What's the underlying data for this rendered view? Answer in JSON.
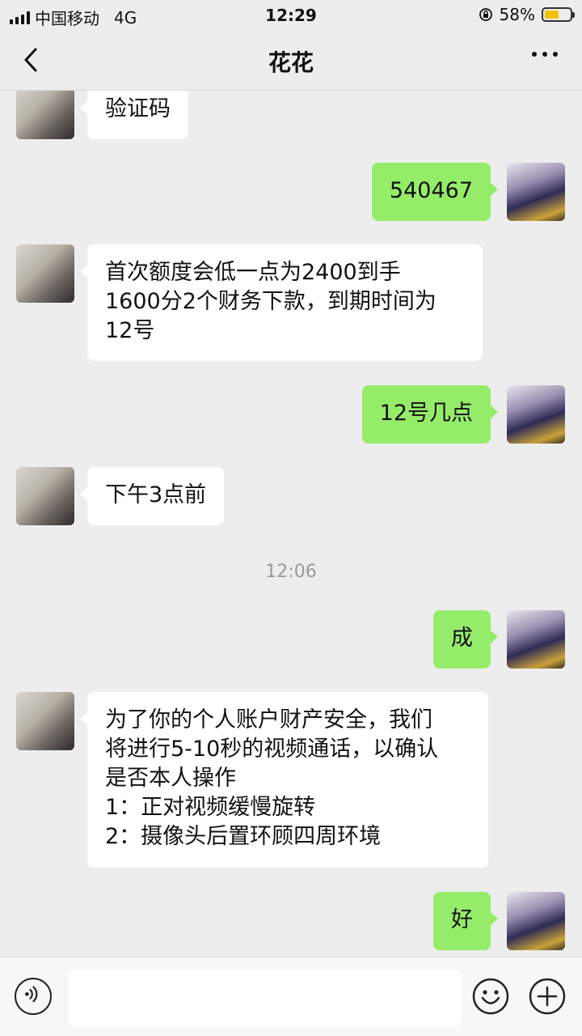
{
  "status_bar": {
    "carrier": "中国移动",
    "network": "4G",
    "time": "12:29",
    "battery_percent": "58%",
    "battery_level": 0.58
  },
  "nav": {
    "title": "花花",
    "back_icon": "chevron-left-icon",
    "more_icon": "more-dots-icon"
  },
  "messages": [
    {
      "side": "in",
      "text": "验证码"
    },
    {
      "side": "out",
      "text": "540467"
    },
    {
      "side": "in",
      "text": "首次额度会低一点为2400到手\n1600分2个财务下款，到期时间为\n12号"
    },
    {
      "side": "out",
      "text": "12号几点"
    },
    {
      "side": "in",
      "text": "下午3点前"
    },
    {
      "side": "out",
      "text": "成"
    },
    {
      "side": "in",
      "text": "为了你的个人账户财产安全，我们\n将进行5-10秒的视频通话，以确认\n是否本人操作\n1：正对视频缓慢旋转\n2：摄像头后置环顾四周环境"
    },
    {
      "side": "out",
      "text": "好"
    }
  ],
  "timestamp": "12:06",
  "input_bar": {
    "voice_icon": "voice-icon",
    "emoji_icon": "emoji-icon",
    "plus_icon": "plus-icon",
    "input_value": ""
  },
  "colors": {
    "background": "#ededed",
    "incoming_bubble": "#ffffff",
    "outgoing_bubble": "#95ec69",
    "battery": "#f5c000"
  }
}
